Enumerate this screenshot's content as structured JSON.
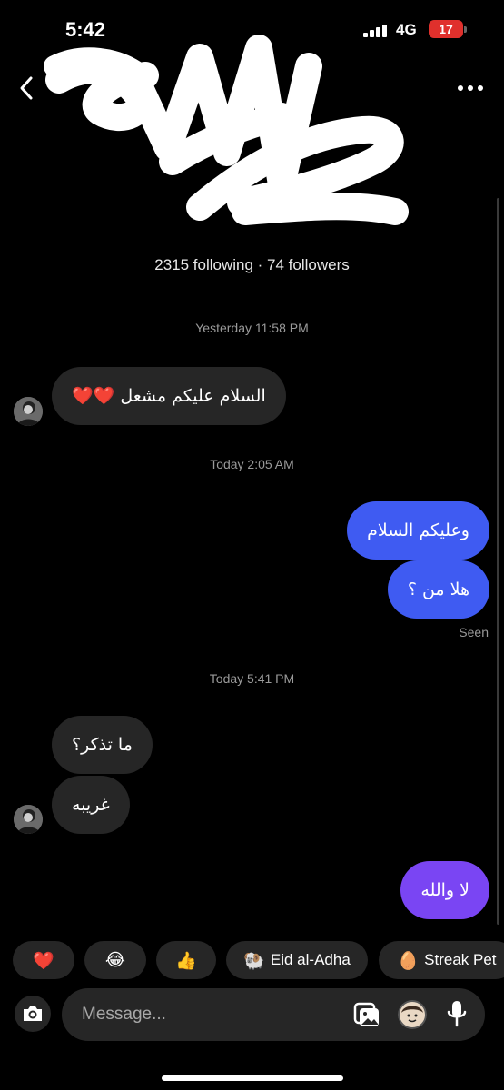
{
  "status_bar": {
    "time": "5:42",
    "network": "4G",
    "battery": "17"
  },
  "header": {
    "back_icon": "chevron-left-icon",
    "more_icon": "more-horizontal-icon",
    "profile_stats": "2315 following · 74 followers"
  },
  "conversation": {
    "timestamps": [
      "Yesterday 11:58 PM",
      "Today 2:05 AM",
      "Today 5:41 PM"
    ],
    "messages": [
      {
        "direction": "incoming",
        "text": "السلام عليكم مشعل ❤️❤️"
      },
      {
        "direction": "outgoing",
        "text": "وعليكم السلام"
      },
      {
        "direction": "outgoing",
        "text": "هلا من ؟"
      },
      {
        "direction": "incoming",
        "text": "ما تذكر؟"
      },
      {
        "direction": "incoming",
        "text": "غريبه"
      },
      {
        "direction": "outgoing",
        "text": "لا والله"
      }
    ],
    "seen_label": "Seen"
  },
  "quick_reactions": [
    {
      "emoji": "❤️",
      "label": ""
    },
    {
      "emoji": "😂",
      "label": ""
    },
    {
      "emoji": "👍",
      "label": ""
    },
    {
      "emoji": "🐏",
      "label": "Eid al-Adha"
    },
    {
      "emoji": "🥚",
      "label": "Streak Pet"
    }
  ],
  "composer": {
    "placeholder": "Message...",
    "icons": [
      "camera-icon",
      "gallery-icon",
      "sticker-icon",
      "microphone-icon"
    ]
  },
  "colors": {
    "background": "#000000",
    "incoming_bubble": "#262626",
    "outgoing_bubble": "#3f5bf2",
    "outgoing_bubble_last": "#7a45f3",
    "battery_low": "#e0302c"
  }
}
